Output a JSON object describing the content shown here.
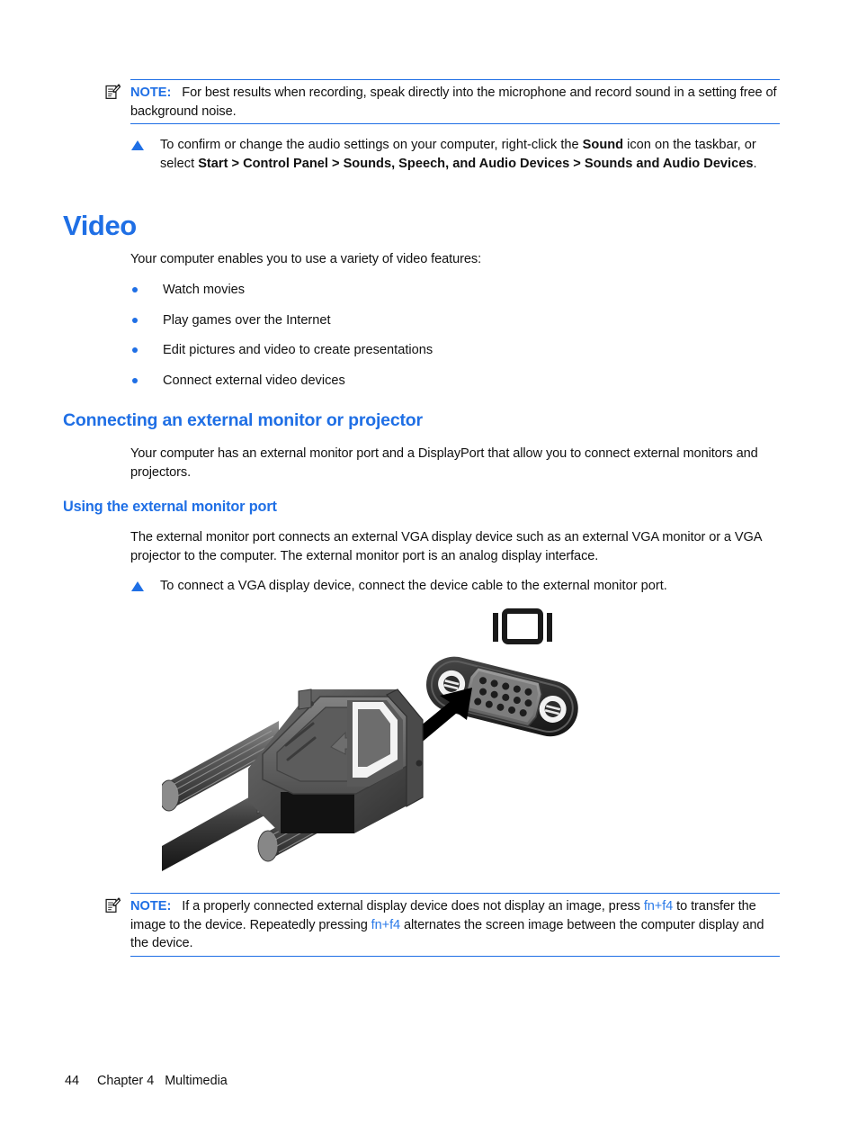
{
  "page": {
    "number": "44",
    "chapter": "Chapter 4",
    "chapter_title": "Multimedia",
    "footer_text": "44     Chapter 4   Multimedia",
    "accent_color": "#1f6fe5",
    "text_color": "#111111",
    "background_color": "#ffffff"
  },
  "note_top": {
    "icon": "note-pad-pencil-icon",
    "label": "NOTE:",
    "text": "For best results when recording, speak directly into the microphone and record sound in a setting free of background noise."
  },
  "audio_step": {
    "icon": "triangle-bullet-icon",
    "segments": [
      {
        "text": "To confirm or change the audio settings on your computer, right-click the ",
        "bold": false
      },
      {
        "text": "Sound",
        "bold": true
      },
      {
        "text": " icon on the taskbar, or select ",
        "bold": false
      },
      {
        "text": "Start > Control Panel > Sounds, Speech, and Audio Devices > Sounds and Audio Devices",
        "bold": true
      },
      {
        "text": ".",
        "bold": false
      }
    ],
    "plain_text": "To confirm or change the audio settings on your computer, right-click the Sound icon on the taskbar, or select Start > Control Panel > Sounds, Speech, and Audio Devices > Sounds and Audio Devices."
  },
  "video_section": {
    "heading": "Video",
    "intro": "Your computer enables you to use a variety of video features:",
    "bullets": [
      "Watch movies",
      "Play games over the Internet",
      "Edit pictures and video to create presentations",
      "Connect external video devices"
    ]
  },
  "connecting_section": {
    "heading": "Connecting an external monitor or projector",
    "paragraph": "Your computer has an external monitor port and a DisplayPort that allow you to connect external monitors and projectors."
  },
  "using_port_section": {
    "heading": "Using the external monitor port",
    "paragraph": "The external monitor port connects an external VGA display device such as an external VGA monitor or a VGA projector to the computer. The external monitor port is an analog display interface.",
    "step": {
      "icon": "triangle-bullet-icon",
      "text": "To connect a VGA display device, connect the device cable to the external monitor port."
    }
  },
  "figure": {
    "name": "vga-cable-to-external-monitor-port-illustration",
    "description": "A VGA cable connector with thumbscrews being inserted, indicated by a black arrow, into the computer's external monitor port, which is labeled with a monitor icon.",
    "port_icon": "external-monitor-icon",
    "arrow_icon": "insertion-arrow-icon",
    "pin_rows": [
      5,
      5,
      5
    ]
  },
  "note_bottom": {
    "icon": "note-pad-pencil-icon",
    "label": "NOTE:",
    "segments": [
      {
        "text": "If a properly connected external display device does not display an image, press ",
        "style": "plain"
      },
      {
        "text": "fn+f4",
        "style": "key"
      },
      {
        "text": " to transfer the image to the device. Repeatedly pressing ",
        "style": "plain"
      },
      {
        "text": "fn+f4",
        "style": "key"
      },
      {
        "text": " alternates the screen image between the computer display and the device.",
        "style": "plain"
      }
    ],
    "plain_text": "If a properly connected external display device does not display an image, press fn+f4 to transfer the image to the device. Repeatedly pressing fn+f4 alternates the screen image between the computer display and the device.",
    "key_combo": "fn+f4"
  }
}
